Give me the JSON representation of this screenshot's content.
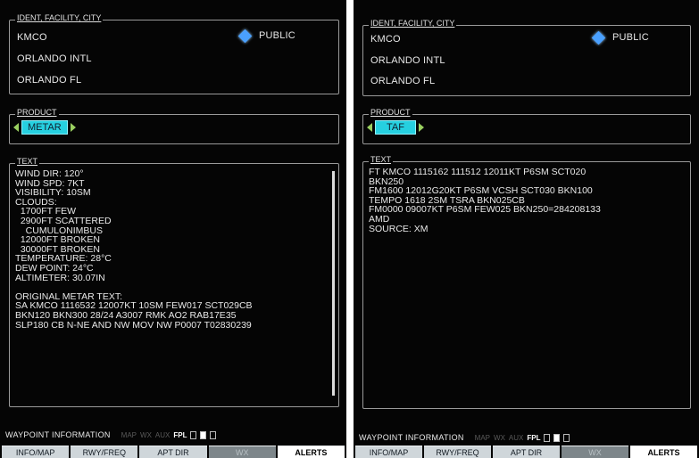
{
  "left": {
    "ident": {
      "legend": "IDENT, FACILITY, CITY",
      "id": "KMCO",
      "facility": "ORLANDO INTL",
      "city": "ORLANDO FL",
      "public_label": "PUBLIC"
    },
    "product": {
      "legend": "PRODUCT",
      "value": "METAR"
    },
    "text": {
      "legend": "TEXT",
      "lines": [
        "WIND DIR: 120°",
        "WIND SPD: 7KT",
        "VISIBILITY: 10SM",
        "CLOUDS:",
        "  1700FT FEW",
        "  2900FT SCATTERED",
        "    CUMULONIMBUS",
        "  12000FT BROKEN",
        "  30000FT BROKEN",
        "TEMPERATURE: 28°C",
        "DEW POINT: 24°C",
        "ALTIMETER: 30.07IN",
        "",
        "ORIGINAL METAR TEXT:",
        "SA KMCO 1116532 12007KT 10SM FEW017 SCT029CB",
        "BKN120 BKN300 28/24 A3007 RMK AO2 RAB17E35",
        "SLP180 CB N-NE AND NW MOV NW P0007 T02830239"
      ]
    },
    "status": {
      "title": "WAYPOINT INFORMATION",
      "pages": [
        "MAP",
        "WX",
        "AUX",
        "FPL"
      ],
      "active_page": "FPL"
    },
    "softkeys": [
      "INFO/MAP",
      "RWY/FREQ",
      "APT DIR",
      "WX",
      "ALERTS"
    ]
  },
  "right": {
    "ident": {
      "legend": "IDENT, FACILITY, CITY",
      "id": "KMCO",
      "facility": "ORLANDO INTL",
      "city": "ORLANDO FL",
      "public_label": "PUBLIC"
    },
    "product": {
      "legend": "PRODUCT",
      "value": "TAF"
    },
    "text": {
      "legend": "TEXT",
      "lines": [
        "FT KMCO 1115162 111512 12011KT P6SM SCT020",
        "BKN250",
        "FM1600 12012G20KT P6SM VCSH SCT030 BKN100",
        "TEMPO 1618 2SM TSRA BKN025CB",
        "FM0000 09007KT P6SM FEW025 BKN250=284208133",
        "AMD",
        "SOURCE: XM"
      ]
    },
    "status": {
      "title": "WAYPOINT INFORMATION",
      "pages": [
        "MAP",
        "WX",
        "AUX",
        "FPL"
      ],
      "active_page": "FPL"
    },
    "softkeys": [
      "INFO/MAP",
      "RWY/FREQ",
      "APT DIR",
      "WX",
      "ALERTS"
    ]
  },
  "colors": {
    "background": "#050505",
    "text": "#e8e8e8",
    "product_highlight": "#26d0e0",
    "public_diamond": "#4aa0ff",
    "arrow": "#9ad060",
    "softkey": "#cfd6da"
  }
}
